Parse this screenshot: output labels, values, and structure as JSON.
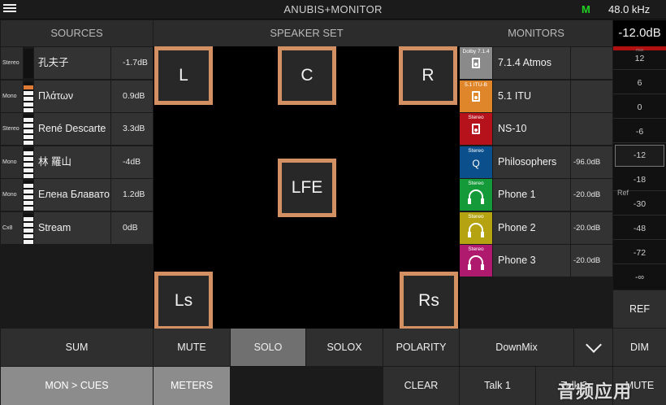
{
  "app": {
    "title": "ANUBIS+MONITOR",
    "mode_indicator": "M",
    "sample_rate": "48.0 kHz",
    "menu_icon": "hamburger-icon"
  },
  "sections": {
    "sources": "SOURCES",
    "speaker_set": "SPEAKER SET",
    "monitors": "MONITORS"
  },
  "sources": [
    {
      "tag": "Stereo",
      "name": "孔夫子",
      "db": "-1.7dB"
    },
    {
      "tag": "Mono",
      "name": "Πλάτων",
      "db": "0.9dB"
    },
    {
      "tag": "Stereo",
      "name": "René Descarte",
      "db": "3.3dB"
    },
    {
      "tag": "Mono",
      "name": "林 羅山",
      "db": "-4dB"
    },
    {
      "tag": "Mono",
      "name": "Елена Блавато",
      "db": "1.2dB"
    },
    {
      "tag": "Cx8",
      "name": "Stream",
      "db": "0dB"
    }
  ],
  "speakers": [
    "L",
    "C",
    "R",
    "LFE",
    "Ls",
    "Rs"
  ],
  "monitors": [
    {
      "format": "Dolby 7.1.4",
      "name": "7.1.4 Atmos",
      "db": "",
      "color": "#8a8a8a",
      "icon": "speaker-icon"
    },
    {
      "format": "5.1 ITU-B",
      "name": "5.1 ITU",
      "db": "",
      "color": "#e0862a",
      "icon": "speaker-icon"
    },
    {
      "format": "Stereo",
      "name": "NS-10",
      "db": "",
      "color": "#b5121b",
      "icon": "speaker-icon"
    },
    {
      "format": "Stereo",
      "name": "Philosophers",
      "db": "-96.0dB",
      "color": "#0b4f8c",
      "icon": "q-icon",
      "glyph": "Q"
    },
    {
      "format": "Stereo",
      "name": "Phone 1",
      "db": "-20.0dB",
      "color": "#159a3a",
      "icon": "headphones-icon"
    },
    {
      "format": "Stereo",
      "name": "Phone 2",
      "db": "-20.0dB",
      "color": "#b6a312",
      "icon": "headphones-icon"
    },
    {
      "format": "Stereo",
      "name": "Phone 3",
      "db": "-20.0dB",
      "color": "#b01a6e",
      "icon": "headphones-icon"
    }
  ],
  "level": {
    "value": "-12.0dB",
    "max_label": "max",
    "ticks": [
      "12",
      "6",
      "0",
      "-6",
      "-12",
      "-18",
      "-30",
      "-48",
      "-72",
      "-∞"
    ],
    "ref_marker": "Ref",
    "selected_tick": "-12"
  },
  "buttons": {
    "sum": "SUM",
    "mute": "MUTE",
    "solo": "SOLO",
    "solox": "SOLOX",
    "polarity": "POLARITY",
    "downmix": "DownMix",
    "ref": "REF",
    "dim": "DIM",
    "mon_cues": "MON > CUES",
    "meters": "METERS",
    "clear": "CLEAR",
    "talk1": "Talk 1",
    "talk2": "Talk 2",
    "mute_main": "MUTE"
  },
  "watermark": "音频应用"
}
